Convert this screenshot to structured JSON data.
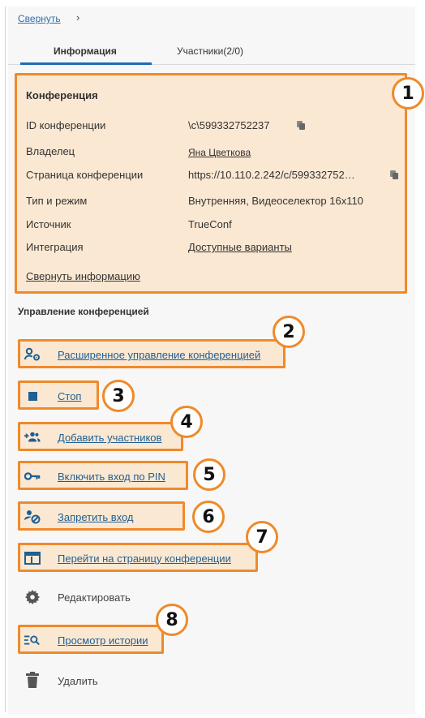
{
  "header": {
    "collapse_label": "Свернуть",
    "chevron": "›"
  },
  "tabs": [
    {
      "label": "Информация",
      "active": true
    },
    {
      "label": "Участники(2/0)",
      "active": false
    }
  ],
  "conference_info": {
    "title": "Конференция",
    "rows": [
      {
        "label": "ID конференции",
        "value": "\\c\\599332752237"
      },
      {
        "label": "Владелец",
        "value": "Яна Цветкова"
      },
      {
        "label": "Страница конференции",
        "value": "https://10.110.2.242/c/599332752…"
      },
      {
        "label": "Тип и режим",
        "value": "Внутренняя, Видеоселектор 16x110"
      },
      {
        "label": "Источник",
        "value": "TrueConf"
      },
      {
        "label": "Интеграция",
        "value": "Доступные варианты"
      }
    ],
    "collapse_label": "Свернуть информацию"
  },
  "management": {
    "title": "Управление конференцией",
    "actions": [
      {
        "label": "Расширенное управление конференцией",
        "icon": "user-settings-icon"
      },
      {
        "label": "Стоп",
        "icon": "stop-icon"
      },
      {
        "label": "Добавить участников",
        "icon": "add-users-icon"
      },
      {
        "label": "Включить вход по PIN",
        "icon": "key-icon"
      },
      {
        "label": "Запретить вход",
        "icon": "user-block-icon"
      },
      {
        "label": "Перейти на страницу конференции",
        "icon": "browser-window-icon"
      },
      {
        "label": "Редактировать",
        "icon": "gear-icon"
      },
      {
        "label": "Просмотр истории",
        "icon": "history-search-icon"
      },
      {
        "label": "Удалить",
        "icon": "trash-icon"
      }
    ]
  },
  "callouts": [
    "1",
    "2",
    "3",
    "4",
    "5",
    "6",
    "7",
    "8"
  ],
  "colors": {
    "accent": "#ef8a2b",
    "highlight": "#fbe8d3",
    "link": "#1f5f93",
    "tab_active": "#1e6bb8"
  }
}
